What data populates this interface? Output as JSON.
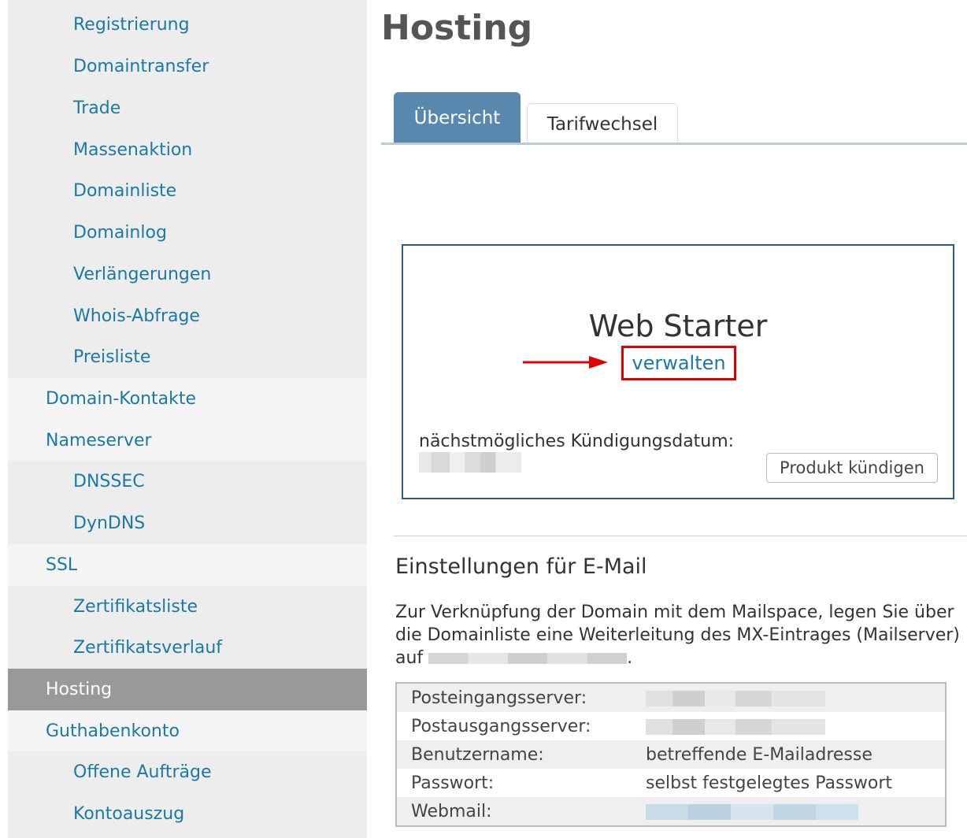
{
  "sidebar": {
    "items": [
      {
        "label": "Registrierung",
        "level": "sub",
        "active": false
      },
      {
        "label": "Domaintransfer",
        "level": "sub",
        "active": false
      },
      {
        "label": "Trade",
        "level": "sub",
        "active": false
      },
      {
        "label": "Massenaktion",
        "level": "sub",
        "active": false
      },
      {
        "label": "Domainliste",
        "level": "sub",
        "active": false
      },
      {
        "label": "Domainlog",
        "level": "sub",
        "active": false
      },
      {
        "label": "Verlängerungen",
        "level": "sub",
        "active": false
      },
      {
        "label": "Whois-Abfrage",
        "level": "sub",
        "active": false
      },
      {
        "label": "Preisliste",
        "level": "sub",
        "active": false
      },
      {
        "label": "Domain-Kontakte",
        "level": "top",
        "active": false
      },
      {
        "label": "Nameserver",
        "level": "top",
        "active": false
      },
      {
        "label": "DNSSEC",
        "level": "sub",
        "active": false
      },
      {
        "label": "DynDNS",
        "level": "sub",
        "active": false
      },
      {
        "label": "SSL",
        "level": "top",
        "active": false
      },
      {
        "label": "Zertifikatsliste",
        "level": "sub",
        "active": false
      },
      {
        "label": "Zertifikatsverlauf",
        "level": "sub",
        "active": false
      },
      {
        "label": "Hosting",
        "level": "top",
        "active": true
      },
      {
        "label": "Guthabenkonto",
        "level": "top",
        "active": false
      },
      {
        "label": "Offene Aufträge",
        "level": "sub",
        "active": false
      },
      {
        "label": "Kontoauszug",
        "level": "sub",
        "active": false
      }
    ]
  },
  "page": {
    "title": "Hosting"
  },
  "tabs": [
    {
      "label": "Übersicht",
      "active": true
    },
    {
      "label": "Tarifwechsel",
      "active": false
    }
  ],
  "product": {
    "name": "Web Starter",
    "manage_link": "verwalten",
    "cancel_date_label": "nächstmögliches Kündigungsdatum:",
    "cancel_button": "Produkt kündigen"
  },
  "email": {
    "heading": "Einstellungen für E-Mail",
    "text_before": "Zur Verknüpfung der Domain mit dem Mailspace, legen Sie über die Domainliste eine Weiterleitung des MX-Eintrages (Mailserver) auf ",
    "text_after": ".",
    "rows": [
      {
        "key": "Posteingangsserver:",
        "value": ""
      },
      {
        "key": "Postausgangsserver:",
        "value": ""
      },
      {
        "key": "Benutzername:",
        "value": "betreffende E-Mailadresse"
      },
      {
        "key": "Passwort:",
        "value": "selbst festgelegtes Passwort"
      },
      {
        "key": "Webmail:",
        "value": ""
      }
    ]
  },
  "colors": {
    "link": "#1a7aa6",
    "tab_active": "#5888ad",
    "highlight": "#e00000",
    "box_border": "#2c5b86"
  }
}
